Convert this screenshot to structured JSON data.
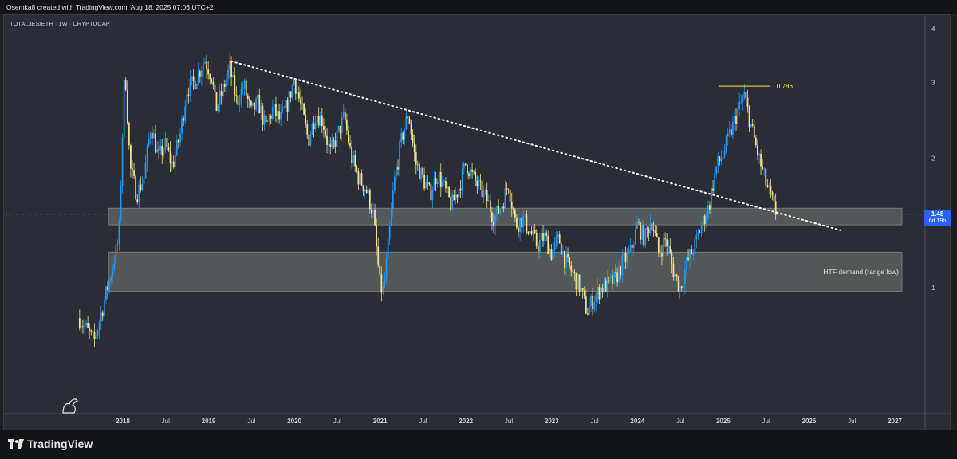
{
  "header": {
    "title": "Osemka8 created with TradingView.com, Aug 18, 2025 07:06 UTC+2"
  },
  "symbol_info": "TOTAL3ES/ETH · 1W · CRYPTOCAP",
  "brand": {
    "name": "TradingView"
  },
  "price_tag": {
    "price": "1.48",
    "countdown": "6d 19h"
  },
  "colors": {
    "bull": "#2196f3",
    "bear": "#f0e08a",
    "zone": "#8c9189",
    "trendline": "#ffffff",
    "fib": "#ffeb3b",
    "price_label_bg": "#2962ff"
  },
  "chart_data": {
    "type": "candlestick",
    "symbol": "TOTAL3ES/ETH",
    "interval": "1W",
    "source": "CRYPTOCAP",
    "y_scale": "log",
    "y_ticks": [
      1,
      2,
      3,
      4
    ],
    "x_ticks": [
      "2018",
      "Jul",
      "2019",
      "Jul",
      "2020",
      "Jul",
      "2021",
      "Jul",
      "2022",
      "Jul",
      "2023",
      "Jul",
      "2024",
      "Jul",
      "2025",
      "Jul",
      "2026",
      "Jul",
      "2027"
    ],
    "last_price": 1.48,
    "series_close": [
      [
        "2017-07-01",
        0.85
      ],
      [
        "2017-09-01",
        0.75
      ],
      [
        "2017-11-01",
        1.02
      ],
      [
        "2017-12-15",
        1.3
      ],
      [
        "2018-01-10",
        3.3
      ],
      [
        "2018-02-01",
        1.9
      ],
      [
        "2018-03-01",
        1.65
      ],
      [
        "2018-04-01",
        1.8
      ],
      [
        "2018-05-01",
        2.4
      ],
      [
        "2018-06-01",
        2.0
      ],
      [
        "2018-07-01",
        2.15
      ],
      [
        "2018-08-01",
        1.92
      ],
      [
        "2018-09-01",
        2.25
      ],
      [
        "2018-10-01",
        2.9
      ],
      [
        "2018-11-01",
        3.0
      ],
      [
        "2018-12-15",
        3.4
      ],
      [
        "2019-01-15",
        3.1
      ],
      [
        "2019-02-01",
        2.6
      ],
      [
        "2019-03-01",
        2.85
      ],
      [
        "2019-04-01",
        3.25
      ],
      [
        "2019-05-01",
        2.7
      ],
      [
        "2019-06-01",
        2.95
      ],
      [
        "2019-07-01",
        2.55
      ],
      [
        "2019-08-01",
        2.7
      ],
      [
        "2019-09-01",
        2.35
      ],
      [
        "2019-10-01",
        2.6
      ],
      [
        "2019-11-01",
        2.45
      ],
      [
        "2019-12-01",
        2.65
      ],
      [
        "2020-01-01",
        3.05
      ],
      [
        "2020-02-01",
        2.6
      ],
      [
        "2020-03-01",
        2.2
      ],
      [
        "2020-04-01",
        2.55
      ],
      [
        "2020-05-01",
        2.45
      ],
      [
        "2020-06-01",
        2.05
      ],
      [
        "2020-07-01",
        2.25
      ],
      [
        "2020-08-01",
        2.5
      ],
      [
        "2020-09-01",
        2.0
      ],
      [
        "2020-10-01",
        1.8
      ],
      [
        "2020-11-01",
        1.7
      ],
      [
        "2020-12-01",
        1.5
      ],
      [
        "2021-01-01",
        1.0
      ],
      [
        "2021-01-15",
        0.98
      ],
      [
        "2021-02-01",
        1.2
      ],
      [
        "2021-03-01",
        1.75
      ],
      [
        "2021-04-01",
        2.2
      ],
      [
        "2021-05-01",
        2.55
      ],
      [
        "2021-06-01",
        1.95
      ],
      [
        "2021-07-01",
        1.8
      ],
      [
        "2021-08-01",
        1.65
      ],
      [
        "2021-09-01",
        1.85
      ],
      [
        "2021-10-01",
        1.7
      ],
      [
        "2021-11-01",
        1.55
      ],
      [
        "2021-12-01",
        1.7
      ],
      [
        "2022-01-01",
        1.95
      ],
      [
        "2022-02-01",
        1.8
      ],
      [
        "2022-03-01",
        1.7
      ],
      [
        "2022-04-01",
        1.6
      ],
      [
        "2022-05-01",
        1.45
      ],
      [
        "2022-06-01",
        1.55
      ],
      [
        "2022-07-01",
        1.75
      ],
      [
        "2022-08-01",
        1.4
      ],
      [
        "2022-09-01",
        1.45
      ],
      [
        "2022-10-01",
        1.35
      ],
      [
        "2022-11-01",
        1.25
      ],
      [
        "2022-12-01",
        1.32
      ],
      [
        "2023-01-01",
        1.2
      ],
      [
        "2023-02-01",
        1.3
      ],
      [
        "2023-03-01",
        1.15
      ],
      [
        "2023-04-01",
        1.08
      ],
      [
        "2023-05-01",
        1.0
      ],
      [
        "2023-06-01",
        0.88
      ],
      [
        "2023-07-01",
        0.95
      ],
      [
        "2023-08-01",
        1.0
      ],
      [
        "2023-09-01",
        1.02
      ],
      [
        "2023-10-01",
        1.05
      ],
      [
        "2023-11-01",
        1.15
      ],
      [
        "2023-12-01",
        1.2
      ],
      [
        "2024-01-01",
        1.4
      ],
      [
        "2024-02-01",
        1.3
      ],
      [
        "2024-03-01",
        1.45
      ],
      [
        "2024-04-01",
        1.2
      ],
      [
        "2024-05-01",
        1.3
      ],
      [
        "2024-06-01",
        1.1
      ],
      [
        "2024-07-01",
        1.0
      ],
      [
        "2024-08-01",
        1.15
      ],
      [
        "2024-09-01",
        1.25
      ],
      [
        "2024-10-01",
        1.4
      ],
      [
        "2024-11-01",
        1.55
      ],
      [
        "2024-12-01",
        1.9
      ],
      [
        "2025-01-01",
        2.05
      ],
      [
        "2025-02-01",
        2.3
      ],
      [
        "2025-03-01",
        2.55
      ],
      [
        "2025-04-01",
        2.8
      ],
      [
        "2025-05-01",
        2.35
      ],
      [
        "2025-06-01",
        2.0
      ],
      [
        "2025-07-01",
        1.75
      ],
      [
        "2025-08-15",
        1.48
      ]
    ],
    "zones": [
      {
        "from": 1.4,
        "to": 1.53
      },
      {
        "from": 0.98,
        "to": 1.21,
        "label": "HTF demand (range low)"
      }
    ],
    "trendline": {
      "start": [
        "2019-04-08",
        3.36
      ],
      "end": [
        "2026-05-15",
        1.36
      ],
      "style": "dotted"
    },
    "fib_level": {
      "label": "0.786",
      "value": 2.94,
      "from": "2024-12-15",
      "to": "2025-07-20"
    }
  }
}
